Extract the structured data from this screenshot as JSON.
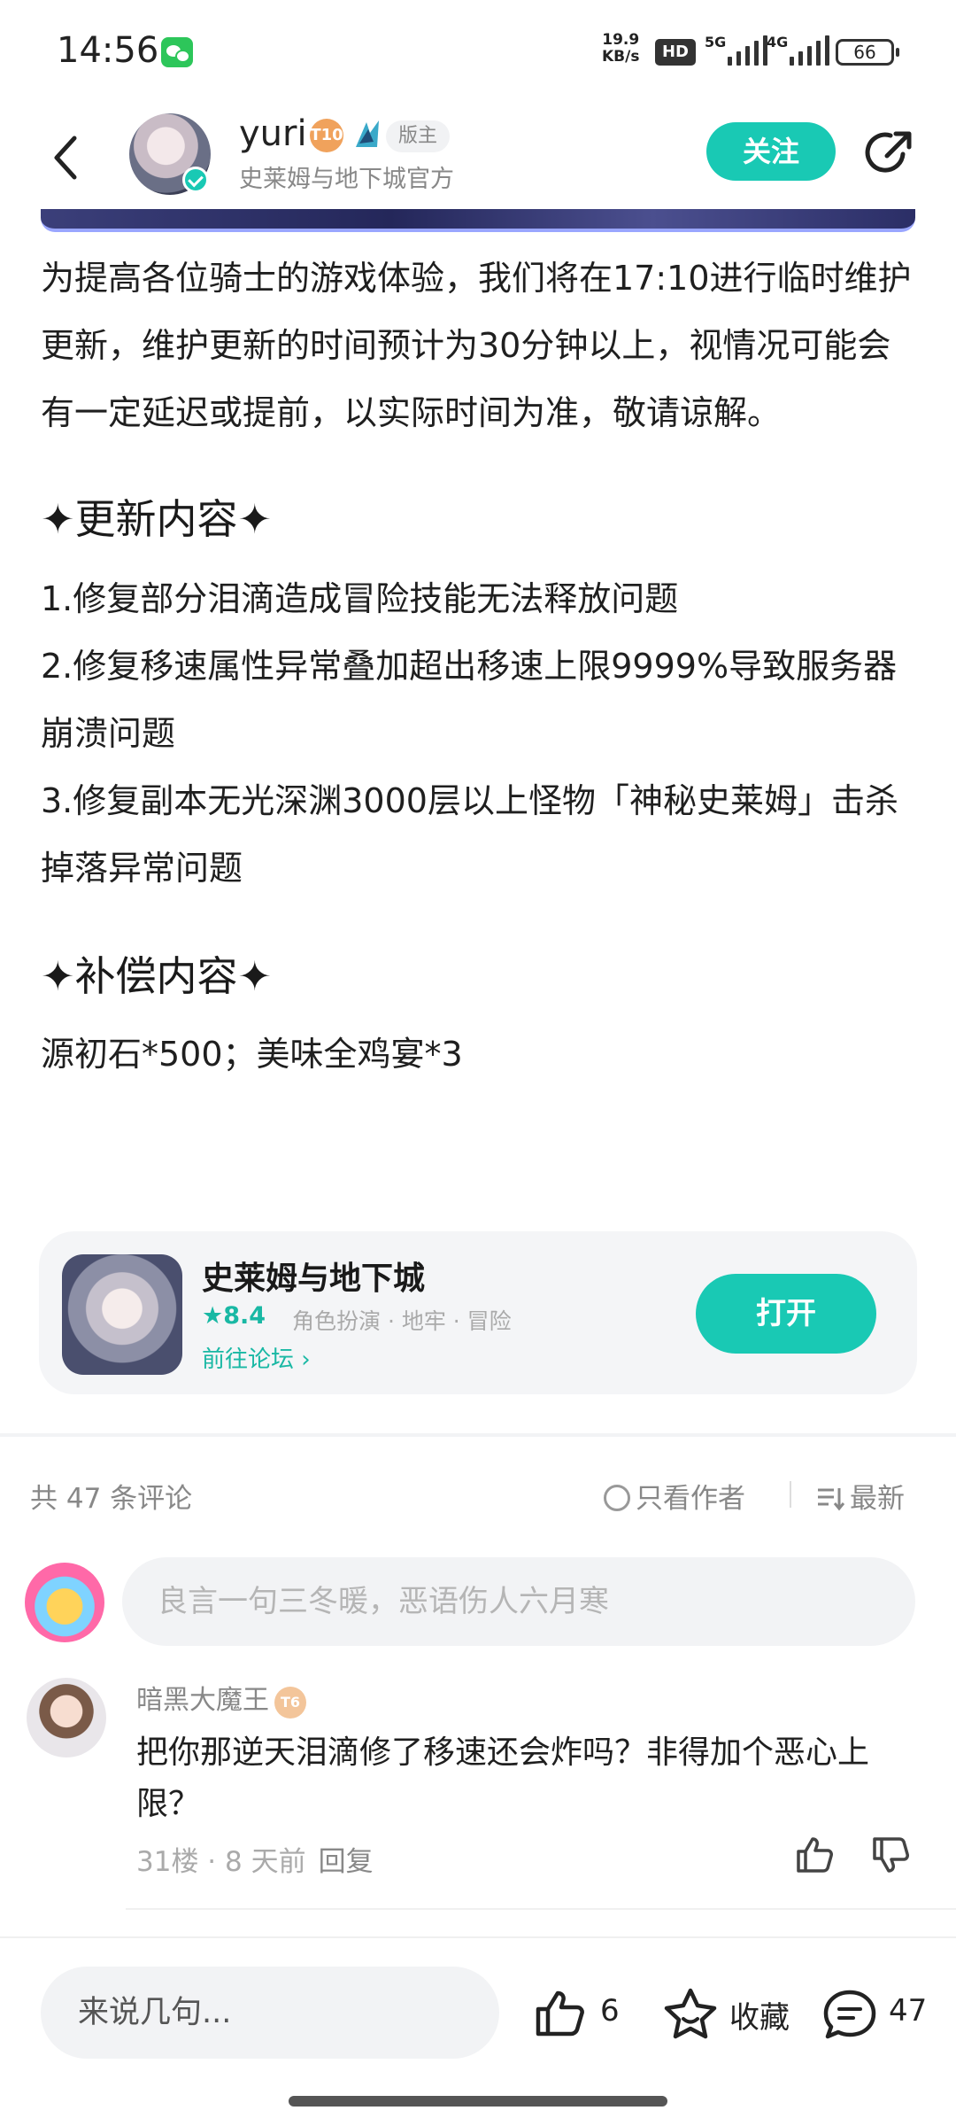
{
  "status_bar": {
    "time": "14:56",
    "speed_value": "19.9",
    "speed_unit": "KB/s",
    "hd_label": "HD",
    "sim1_label": "5G",
    "sim2_label": "4G",
    "battery": "66"
  },
  "header": {
    "author_name": "yuri",
    "level_badge": "T10",
    "mod_label": "版主",
    "author_subtitle": "史莱姆与地下城官方",
    "follow_label": "关注"
  },
  "article": {
    "intro": "为提高各位骑士的游戏体验，我们将在17:10进行临时维护更新，维护更新的时间预计为30分钟以上，视情况可能会有一定延迟或提前，以实际时间为准，敬请谅解。",
    "update_title": "✦更新内容✦",
    "update_items": [
      "1.修复部分泪滴造成冒险技能无法释放问题",
      "2.修复移速属性异常叠加超出移速上限9999%导致服务器崩溃问题",
      "3.修复副本无光深渊3000层以上怪物「神秘史莱姆」击杀掉落异常问题"
    ],
    "comp_title": "✦补偿内容✦",
    "comp_text": "源初石*500；美味全鸡宴*3"
  },
  "game_card": {
    "name": "史莱姆与地下城",
    "rating": "★8.4",
    "tags": "角色扮演 · 地牢 · 冒险",
    "forum_link": "前往论坛 ›",
    "open_label": "打开"
  },
  "comments": {
    "count_label": "共 47 条评论",
    "only_author_label": "只看作者",
    "sort_label": "最新",
    "input_placeholder": "良言一句三冬暖，恶语伤人六月寒",
    "items": [
      {
        "user": "暗黑大魔王",
        "level": "T6",
        "text": "把你那逆天泪滴修了移速还会炸吗？非得加个恶心上限？",
        "meta": "31楼 · 8 天前",
        "reply_label": "回复"
      }
    ]
  },
  "bottom_bar": {
    "reply_placeholder": "来说几句...",
    "like_count": "6",
    "favorite_label": "收藏",
    "comment_count": "47"
  },
  "colors": {
    "accent": "#19c9b4",
    "text_primary": "#1f1f1f",
    "text_secondary": "#888888"
  }
}
